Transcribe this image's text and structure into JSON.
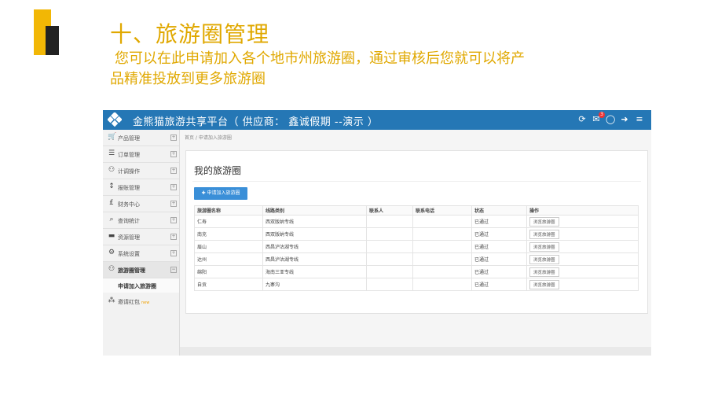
{
  "slide": {
    "title": "十、旅游圈管理",
    "subtitle_line1": "您可以在此申请加入各个地市州旅游圈，通过审核后您就可以将产",
    "subtitle_line2": "品精准投放到更多旅游圈",
    "accent_color": "#e0a800"
  },
  "app": {
    "brand": "金熊猫旅游共享平台（ 供应商： 鑫诚假期 --演示 ）",
    "topbar_color": "#2577b5",
    "topbar_icons": [
      "refresh-icon",
      "mail-icon",
      "chat-icon",
      "logout-icon",
      "menu-icon"
    ],
    "notification_count": "3",
    "sidebar": {
      "items": [
        {
          "label": "产品管理",
          "icon": "cart-icon"
        },
        {
          "label": "订单管理",
          "icon": "list-icon"
        },
        {
          "label": "计调操作",
          "icon": "people-icon"
        },
        {
          "label": "报账管理",
          "icon": "sort-icon"
        },
        {
          "label": "财务中心",
          "icon": "pound-icon"
        },
        {
          "label": "查询统计",
          "icon": "search-icon"
        },
        {
          "label": "资源管理",
          "icon": "folder-icon"
        },
        {
          "label": "系统设置",
          "icon": "gear-icon"
        },
        {
          "label": "旅游圈管理",
          "icon": "circle-group-icon"
        }
      ],
      "sub_item": "申请加入旅游圈",
      "extra_item": {
        "label": "邀请红包",
        "tag": "new",
        "icon": "grid-icon"
      }
    },
    "breadcrumb": "首页 / 申请加入旅游圈",
    "panel": {
      "title": "我的旅游圈",
      "apply_button": "申请加入旅游圈",
      "columns": [
        "旅游圈名称",
        "线路类别",
        "联系人",
        "联系电话",
        "状态",
        "操作"
      ],
      "rows": [
        {
          "name": "仁寿",
          "category": "西双版纳专线",
          "contact": "",
          "phone": "",
          "status": "已通过",
          "action": "浏览旅游圈"
        },
        {
          "name": "南充",
          "category": "西双版纳专线",
          "contact": "",
          "phone": "",
          "status": "已通过",
          "action": "浏览旅游圈"
        },
        {
          "name": "眉山",
          "category": "西昌泸沽湖专线",
          "contact": "",
          "phone": "",
          "status": "已通过",
          "action": "浏览旅游圈"
        },
        {
          "name": "达州",
          "category": "西昌泸沽湖专线",
          "contact": "",
          "phone": "",
          "status": "已通过",
          "action": "浏览旅游圈"
        },
        {
          "name": "绵阳",
          "category": "海南三亚专线",
          "contact": "",
          "phone": "",
          "status": "已通过",
          "action": "浏览旅游圈"
        },
        {
          "name": "自贡",
          "category": "九寨沟",
          "contact": "",
          "phone": "",
          "status": "已通过",
          "action": "浏览旅游圈"
        }
      ]
    }
  }
}
